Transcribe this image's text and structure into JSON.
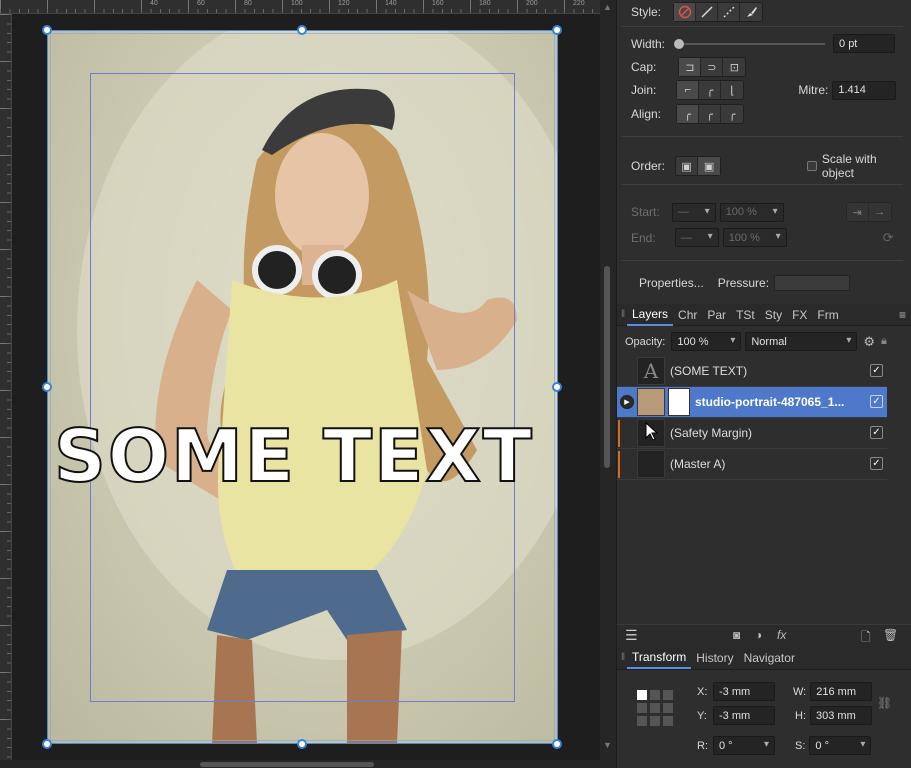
{
  "canvas": {
    "overlay_text": "SOME TEXT",
    "ruler_labels": [
      "40",
      "60",
      "80",
      "100",
      "120",
      "140",
      "160",
      "180",
      "200",
      "220"
    ]
  },
  "stroke": {
    "style_label": "Style:",
    "width_label": "Width:",
    "width_value": "0 pt",
    "cap_label": "Cap:",
    "join_label": "Join:",
    "mitre_label": "Mitre:",
    "mitre_value": "1.414",
    "align_label": "Align:",
    "order_label": "Order:",
    "scale_label": "Scale with object",
    "start_label": "Start:",
    "end_label": "End:",
    "start_pct": "100 %",
    "end_pct": "100 %",
    "properties_label": "Properties...",
    "pressure_label": "Pressure:"
  },
  "layers_panel": {
    "tabs": [
      "Layers",
      "Chr",
      "Par",
      "TSt",
      "Sty",
      "FX",
      "Frm"
    ],
    "opacity_label": "Opacity:",
    "opacity_value": "100 %",
    "blend_mode": "Normal",
    "items": [
      {
        "name": "(SOME TEXT)",
        "selected": false
      },
      {
        "name": "studio-portrait-487065_1...",
        "selected": true
      },
      {
        "name": "(Safety Margin)",
        "selected": false
      },
      {
        "name": "(Master A)",
        "selected": false
      }
    ]
  },
  "transform_panel": {
    "tabs": [
      "Transform",
      "History",
      "Navigator"
    ],
    "x_label": "X:",
    "x_value": "-3 mm",
    "y_label": "Y:",
    "y_value": "-3 mm",
    "w_label": "W:",
    "w_value": "216 mm",
    "h_label": "H:",
    "h_value": "303 mm",
    "r_label": "R:",
    "r_value": "0 °",
    "s_label": "S:",
    "s_value": "0 °"
  },
  "colors": {
    "selection": "#4e78c9",
    "handle_border": "#3a82d8",
    "margin_guide": "#6d7fd0",
    "layer_marker": "#d56a1c"
  }
}
